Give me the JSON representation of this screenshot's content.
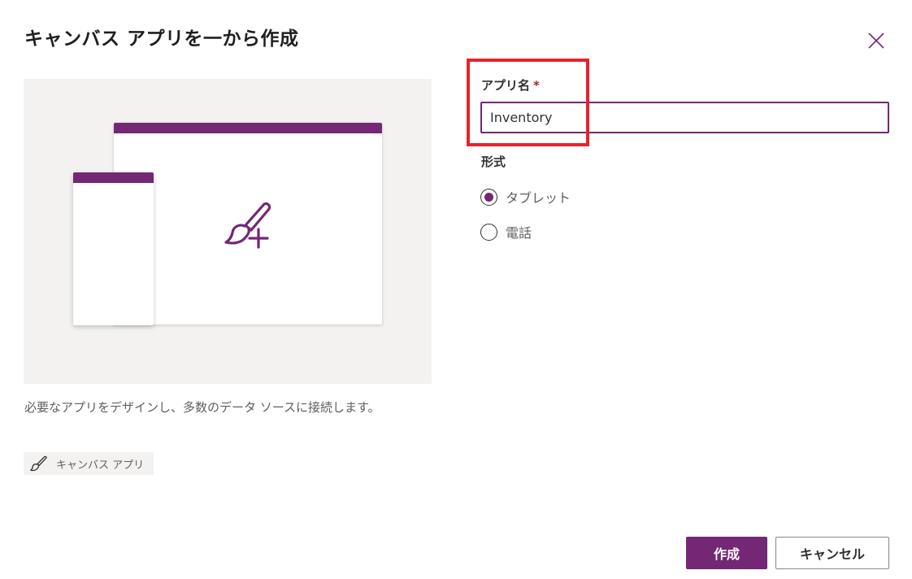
{
  "dialog": {
    "title": "キャンバス アプリを一から作成",
    "close_icon": "close-icon"
  },
  "preview": {
    "accent_color": "#742774",
    "background_color": "#f3f2f1",
    "center_icon": "paintbrush-add-icon",
    "description": "必要なアプリをデザインし、多数のデータ ソースに接続します。",
    "tag": {
      "icon": "paintbrush-icon",
      "label": "キャンバス アプリ"
    }
  },
  "form": {
    "app_name": {
      "label": "アプリ名",
      "required_mark": "*",
      "value": "Inventory"
    },
    "format": {
      "label": "形式",
      "options": [
        {
          "label": "タブレット",
          "selected": true
        },
        {
          "label": "電話",
          "selected": false
        }
      ]
    },
    "highlight_color": "#e5242d"
  },
  "footer": {
    "create_label": "作成",
    "cancel_label": "キャンセル"
  }
}
